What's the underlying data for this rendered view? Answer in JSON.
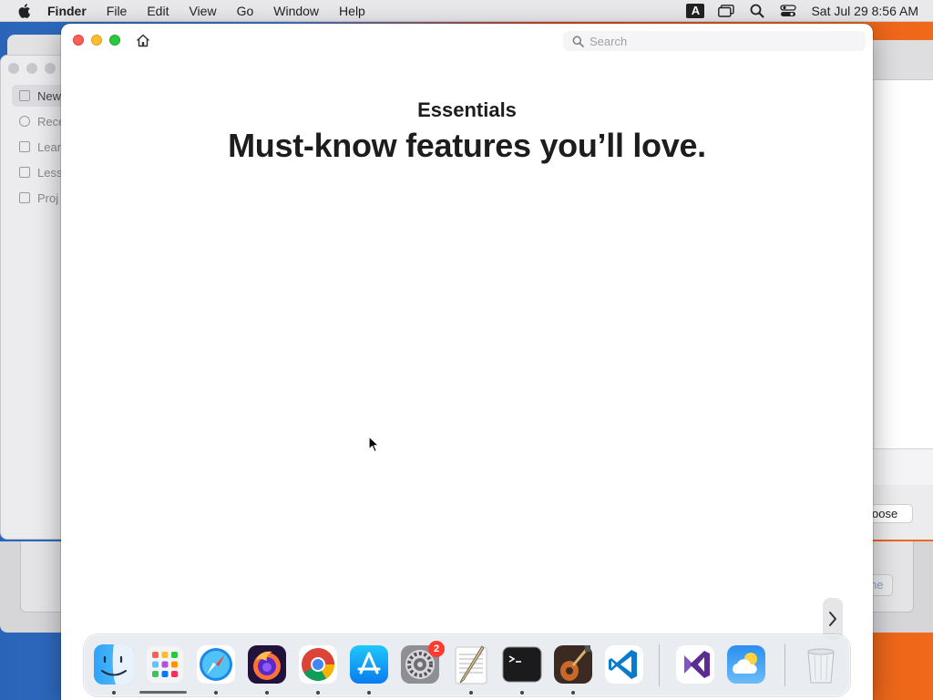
{
  "menubar": {
    "app_name": "Finder",
    "menus": [
      "File",
      "Edit",
      "View",
      "Go",
      "Window",
      "Help"
    ],
    "input_source": "A",
    "clock": "Sat Jul 29  8:56 AM"
  },
  "background_window_left": {
    "sidebar_items": [
      "New",
      "Rece",
      "Lear",
      "Less",
      "Proj"
    ]
  },
  "background_window_right": {
    "choose_button": "oose",
    "secondary_button": "ne"
  },
  "tips_window": {
    "search_placeholder": "Search",
    "section_title": "Essentials",
    "headline": "Must-know features you’ll love."
  },
  "dock": {
    "apps": [
      {
        "name": "Finder",
        "icon": "finder-icon",
        "running": true
      },
      {
        "name": "Launchpad",
        "icon": "launchpad-icon",
        "running": false
      },
      {
        "name": "Safari",
        "icon": "safari-icon",
        "running": true
      },
      {
        "name": "Firefox",
        "icon": "firefox-icon",
        "running": true
      },
      {
        "name": "Chrome",
        "icon": "chrome-icon",
        "running": true
      },
      {
        "name": "App Store",
        "icon": "app-store-icon",
        "running": true
      },
      {
        "name": "System Settings",
        "icon": "system-settings-icon",
        "running": false,
        "badge": "2"
      },
      {
        "name": "TextEdit",
        "icon": "textedit-icon",
        "running": true
      },
      {
        "name": "Terminal",
        "icon": "terminal-icon",
        "running": true
      },
      {
        "name": "Instruments",
        "icon": "instruments-icon",
        "running": true
      },
      {
        "name": "Visual Studio Code",
        "icon": "vscode-icon",
        "running": false
      },
      {
        "name": "Visual Studio",
        "icon": "visual-studio-icon",
        "running": false
      },
      {
        "name": "Weather",
        "icon": "weather-icon",
        "running": false
      },
      {
        "name": "Trash",
        "icon": "trash-icon",
        "running": false
      }
    ]
  },
  "colors": {
    "close": "#ff5f57",
    "minimize": "#febc2e",
    "maximize": "#28c840",
    "badge": "#ff3b30"
  }
}
